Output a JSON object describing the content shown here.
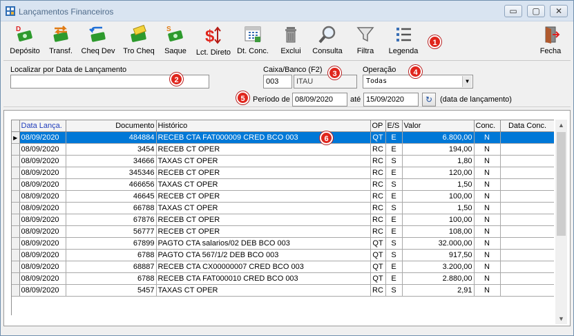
{
  "window": {
    "title": "Lançamentos Financeiros",
    "controls": {
      "minimize": "▭",
      "maximize": "▢",
      "close": "✕"
    }
  },
  "toolbar": {
    "items": [
      {
        "label": "Depósito",
        "icon": "deposit-icon"
      },
      {
        "label": "Transf.",
        "icon": "transfer-icon"
      },
      {
        "label": "Cheq Dev",
        "icon": "returned-check-icon"
      },
      {
        "label": "Tro Cheq",
        "icon": "check-exchange-icon"
      },
      {
        "label": "Saque",
        "icon": "withdraw-icon"
      },
      {
        "label": "Lct. Direto",
        "icon": "direct-entry-icon"
      },
      {
        "label": "Dt. Conc.",
        "icon": "calendar-icon"
      },
      {
        "label": "Exclui",
        "icon": "trash-icon"
      },
      {
        "label": "Consulta",
        "icon": "magnifier-icon"
      },
      {
        "label": "Filtra",
        "icon": "filter-icon"
      },
      {
        "label": "Legenda",
        "icon": "legend-list-icon"
      },
      {
        "label": "Fecha",
        "icon": "exit-door-icon"
      }
    ]
  },
  "badges": [
    "1",
    "2",
    "3",
    "4",
    "5",
    "6"
  ],
  "filters": {
    "search_label": "Localizar por Data de Lançamento",
    "search_value": "",
    "bank_label": "Caixa/Banco (F2)",
    "bank_code": "003",
    "bank_name": "ITAU",
    "operation_label": "Operação",
    "operation_value": "Todas",
    "period_label": "Período de",
    "period_from": "08/09/2020",
    "period_to_label": "até",
    "period_to": "15/09/2020",
    "period_note": "(data de lançamento)",
    "refresh_glyph": "↻"
  },
  "grid": {
    "columns": [
      "Data Lança.",
      "Documento",
      "Histórico",
      "OP",
      "E/S",
      "Valor",
      "Conc.",
      "Data Conc."
    ],
    "row_marker": "▶",
    "rows": [
      [
        "08/09/2020",
        "484884",
        "RECEB CTA FAT000009 CRED BCO 003",
        "QT",
        "E",
        "6.800,00",
        "N",
        ""
      ],
      [
        "08/09/2020",
        "3454",
        "RECEB CT OPER",
        "RC",
        "E",
        "194,00",
        "N",
        ""
      ],
      [
        "08/09/2020",
        "34666",
        "TAXAS CT OPER",
        "RC",
        "S",
        "1,80",
        "N",
        ""
      ],
      [
        "08/09/2020",
        "345346",
        "RECEB CT OPER",
        "RC",
        "E",
        "120,00",
        "N",
        ""
      ],
      [
        "08/09/2020",
        "466656",
        "TAXAS CT OPER",
        "RC",
        "S",
        "1,50",
        "N",
        ""
      ],
      [
        "08/09/2020",
        "46645",
        "RECEB CT OPER",
        "RC",
        "E",
        "100,00",
        "N",
        ""
      ],
      [
        "08/09/2020",
        "66788",
        "TAXAS CT OPER",
        "RC",
        "S",
        "1,50",
        "N",
        ""
      ],
      [
        "08/09/2020",
        "67876",
        "RECEB CT OPER",
        "RC",
        "E",
        "100,00",
        "N",
        ""
      ],
      [
        "08/09/2020",
        "56777",
        "RECEB CT OPER",
        "RC",
        "E",
        "108,00",
        "N",
        ""
      ],
      [
        "08/09/2020",
        "67899",
        "PAGTO CTA salarios/02 DEB BCO 003",
        "QT",
        "S",
        "32.000,00",
        "N",
        ""
      ],
      [
        "08/09/2020",
        "6788",
        "PAGTO CTA 567/1/2 DEB BCO 003",
        "QT",
        "S",
        "917,50",
        "N",
        ""
      ],
      [
        "08/09/2020",
        "68887",
        "RECEB CTA CX00000007 CRED BCO 003",
        "QT",
        "E",
        "3.200,00",
        "N",
        ""
      ],
      [
        "08/09/2020",
        "6788",
        "RECEB CTA FAT000010 CRED BCO 003",
        "QT",
        "E",
        "2.880,00",
        "N",
        ""
      ],
      [
        "08/09/2020",
        "5457",
        "TAXAS CT OPER",
        "RC",
        "S",
        "2,91",
        "N",
        ""
      ]
    ],
    "selected_row": 0
  },
  "scrollbar": {
    "up": "▲",
    "down": "▼"
  },
  "colors": {
    "selection": "#0078d7",
    "badge": "#e0261d",
    "sort_header": "#1f3cbb"
  }
}
